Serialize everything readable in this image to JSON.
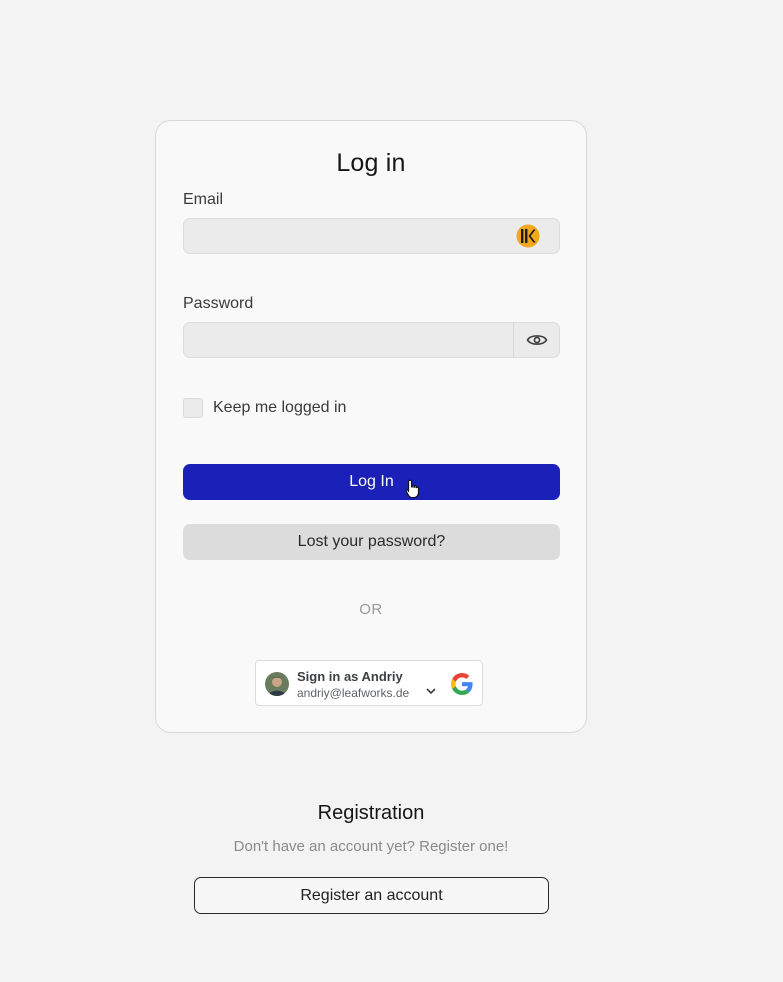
{
  "login": {
    "title": "Log in",
    "email_label": "Email",
    "email_value": "",
    "password_label": "Password",
    "password_value": "",
    "keep_logged_in_label": "Keep me logged in",
    "keep_logged_in_checked": false,
    "login_button": "Log In",
    "lost_password_button": "Lost your password?",
    "or_divider": "OR"
  },
  "google_signin": {
    "name_line": "Sign in as Andriy",
    "email": "andriy@leafworks.de"
  },
  "registration": {
    "title": "Registration",
    "subtitle": "Don't have an account yet? Register one!",
    "button": "Register an account"
  },
  "icons": {
    "email_field_icon": "keeper-logo-icon",
    "password_toggle": "eye-icon",
    "cursor": "hand-pointer-icon",
    "account_menu": "chevron-down-icon",
    "provider_logo": "google-logo-icon"
  },
  "colors": {
    "primary_button": "#1a20b8",
    "secondary_button": "#dcdcdc",
    "keeper_icon": "#f2a81d"
  }
}
